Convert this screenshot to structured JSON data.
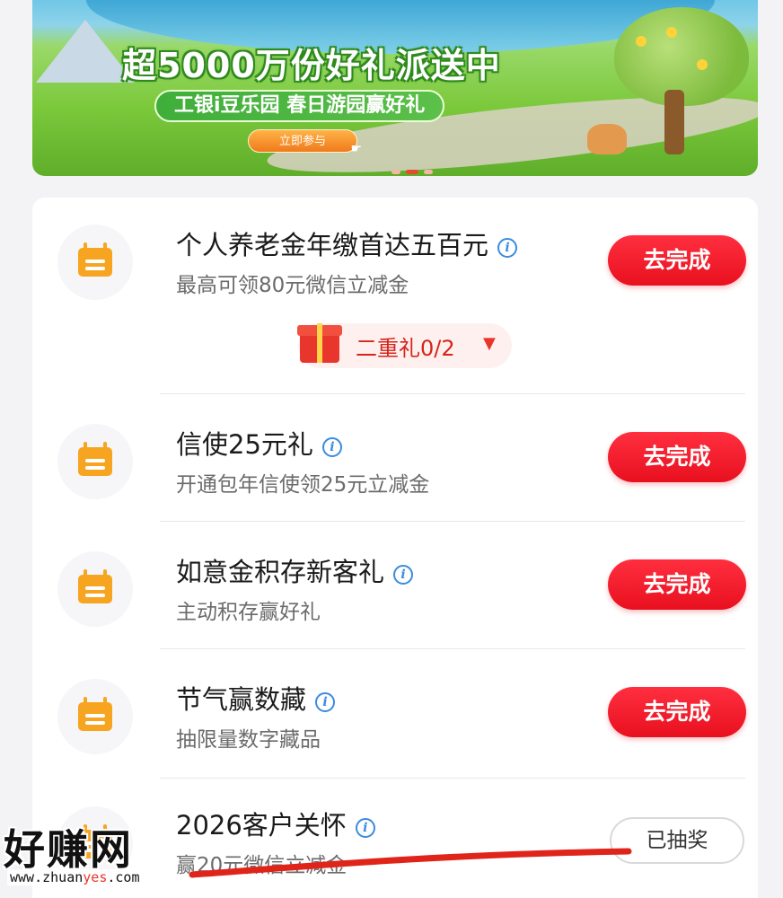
{
  "banner": {
    "title": "超5000万份好礼派送中",
    "subtitle": "工银i豆乐园 春日游园赢好礼",
    "join_label": "立即参与"
  },
  "tasks": [
    {
      "title": "个人养老金年缴首达五百元",
      "desc": "最高可领80元微信立减金",
      "action": "去完成",
      "action_state": "todo",
      "sub_gift": "二重礼0/2"
    },
    {
      "title": "信使25元礼",
      "desc": "开通包年信使领25元立减金",
      "action": "去完成",
      "action_state": "todo"
    },
    {
      "title": "如意金积存新客礼",
      "desc": "主动积存赢好礼",
      "action": "去完成",
      "action_state": "todo"
    },
    {
      "title": "节气赢数藏",
      "desc": "抽限量数字藏品",
      "action": "去完成",
      "action_state": "todo"
    },
    {
      "title": "2026客户关怀",
      "desc": "赢20元微信立减金",
      "action": "已抽奖",
      "action_state": "done"
    }
  ],
  "icons": {
    "task_icon": "calendar-icon",
    "info_icon": "info-icon",
    "gift_icon": "gift-box-icon",
    "expand_icon": "chevron-down-icon"
  },
  "watermark": {
    "text": "好赚网",
    "url_prefix": "www.zhuan",
    "url_highlight": "yes",
    "url_suffix": ".com"
  },
  "colors": {
    "primary_button": "#e8101f",
    "task_icon": "#f7a521",
    "info_icon": "#3a8be0",
    "annotation_stroke": "#e0241a"
  }
}
